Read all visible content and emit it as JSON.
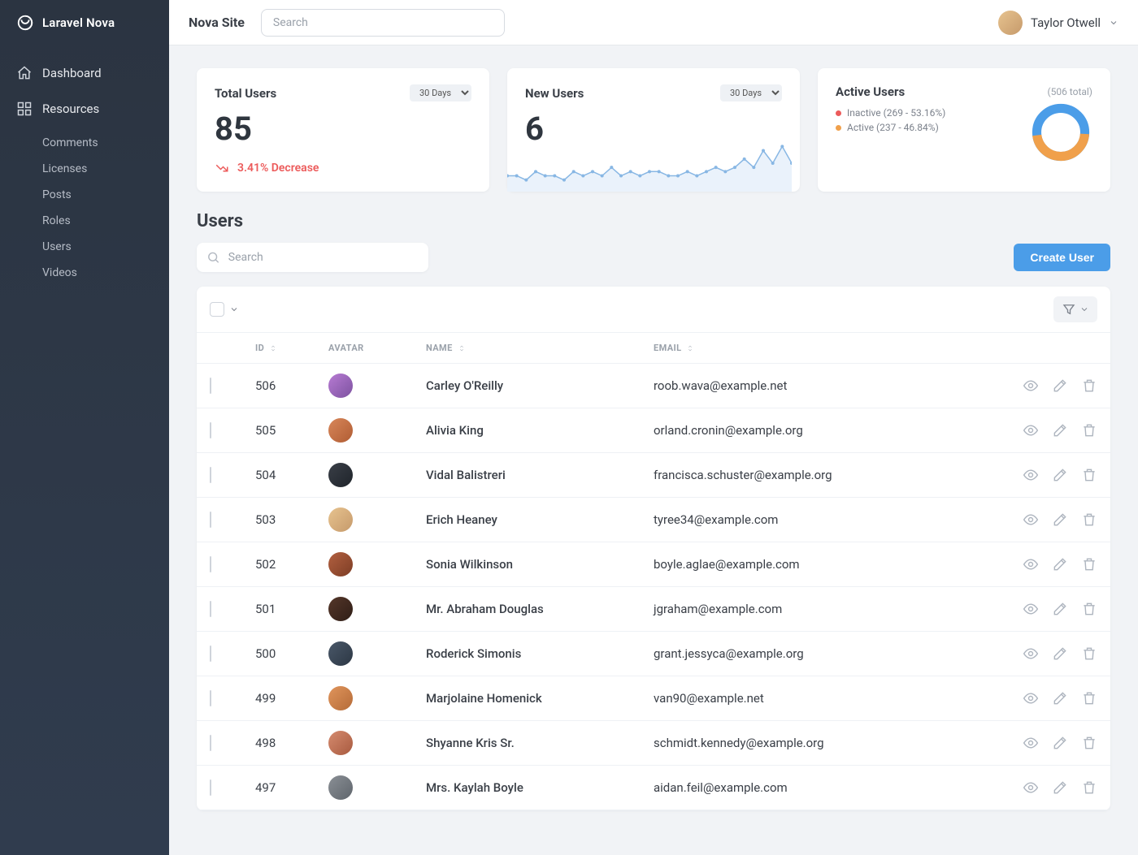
{
  "brand": {
    "name": "Laravel Nova"
  },
  "sidebar": {
    "dashboard": "Dashboard",
    "resources": "Resources",
    "items": [
      "Comments",
      "Licenses",
      "Posts",
      "Roles",
      "Users",
      "Videos"
    ]
  },
  "topbar": {
    "site": "Nova Site",
    "search_placeholder": "Search",
    "user_name": "Taylor Otwell"
  },
  "metrics": {
    "total_users": {
      "title": "Total Users",
      "period": "30 Days",
      "value": "85",
      "trend": "3.41% Decrease"
    },
    "new_users": {
      "title": "New Users",
      "period": "30 Days",
      "value": "6"
    },
    "active_users": {
      "title": "Active Users",
      "total": "(506 total)",
      "legend": {
        "inactive": "Inactive (269 - 53.16%)",
        "active": "Active (237 - 46.84%)"
      }
    }
  },
  "section": {
    "title": "Users",
    "search_placeholder": "Search",
    "create_btn": "Create User"
  },
  "table": {
    "headers": {
      "id": "ID",
      "avatar": "AVATAR",
      "name": "NAME",
      "email": "EMAIL"
    },
    "rows": [
      {
        "id": "506",
        "name": "Carley O'Reilly",
        "email": "roob.wava@example.net",
        "av": "av1"
      },
      {
        "id": "505",
        "name": "Alivia King",
        "email": "orland.cronin@example.org",
        "av": "av2"
      },
      {
        "id": "504",
        "name": "Vidal Balistreri",
        "email": "francisca.schuster@example.org",
        "av": "av3"
      },
      {
        "id": "503",
        "name": "Erich Heaney",
        "email": "tyree34@example.com",
        "av": "av4"
      },
      {
        "id": "502",
        "name": "Sonia Wilkinson",
        "email": "boyle.aglae@example.com",
        "av": "av5"
      },
      {
        "id": "501",
        "name": "Mr. Abraham Douglas",
        "email": "jgraham@example.com",
        "av": "av6"
      },
      {
        "id": "500",
        "name": "Roderick Simonis",
        "email": "grant.jessyca@example.org",
        "av": "av7"
      },
      {
        "id": "499",
        "name": "Marjolaine Homenick",
        "email": "van90@example.net",
        "av": "av8"
      },
      {
        "id": "498",
        "name": "Shyanne Kris Sr.",
        "email": "schmidt.kennedy@example.org",
        "av": "av9"
      },
      {
        "id": "497",
        "name": "Mrs. Kaylah Boyle",
        "email": "aidan.feil@example.com",
        "av": "av10"
      }
    ]
  },
  "chart_data": [
    {
      "type": "line",
      "title": "New Users",
      "ylim": [
        0,
        12
      ],
      "values": [
        3,
        3,
        2,
        4,
        3,
        3,
        2,
        4,
        3,
        4,
        3,
        5,
        3,
        4,
        3,
        4,
        4,
        3,
        3,
        4,
        3,
        4,
        5,
        4,
        5,
        7,
        5,
        9,
        6,
        10,
        6
      ]
    },
    {
      "type": "pie",
      "title": "Active Users",
      "series": [
        {
          "name": "Inactive",
          "value": 269,
          "pct": 53.16,
          "color": "#ec5b5b"
        },
        {
          "name": "Active",
          "value": 237,
          "pct": 46.84,
          "color": "#f0a04b"
        }
      ],
      "total": 506
    }
  ]
}
